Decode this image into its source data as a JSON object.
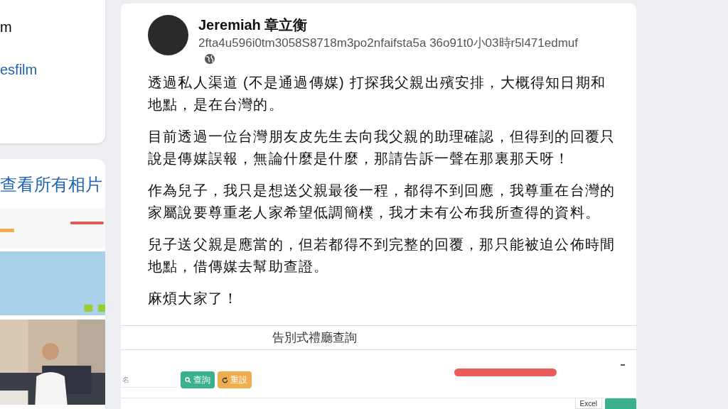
{
  "left_column": {
    "texts": [
      {
        "kind": "plain",
        "text": "m"
      },
      {
        "kind": "link",
        "text": "esfilm"
      }
    ],
    "photos_link": "查看所有相片"
  },
  "post": {
    "author": "Jeremiah 章立衡",
    "meta": "2fta4u596i0tm3058S8718m3po2nfaifsta5a 36o91t0小03時r5l471edmuf",
    "paragraphs": [
      "透過私人渠道 (不是通過傳媒) 打探我父親出殯安排，大概得知日期和地點，是在台灣的。",
      "目前透過一位台灣朋友皮先生去向我父親的助理確認，但得到的回覆只說是傳媒誤報，無論什麼是什麼，那請告訴一聲在那裏那天呀！",
      "作為兒子，我只是想送父親最後一程，都得不到回應，我尊重在台灣的家屬說要尊重老人家希望低調簡樸，我才未有公布我所查得的資料。",
      "兒子送父親是應當的，但若都得不到完整的回覆，那只能被迫公佈時間地點，借傳媒去幫助查證。",
      "麻煩大家了！"
    ],
    "attachment": {
      "title": "告別式禮廳查詢",
      "name_field": {
        "placeholder": "名"
      },
      "buttons": [
        {
          "kind": "search",
          "label": "查詢"
        },
        {
          "kind": "reset",
          "label": "重設"
        }
      ],
      "format_select": {
        "value": "Excel"
      }
    }
  }
}
